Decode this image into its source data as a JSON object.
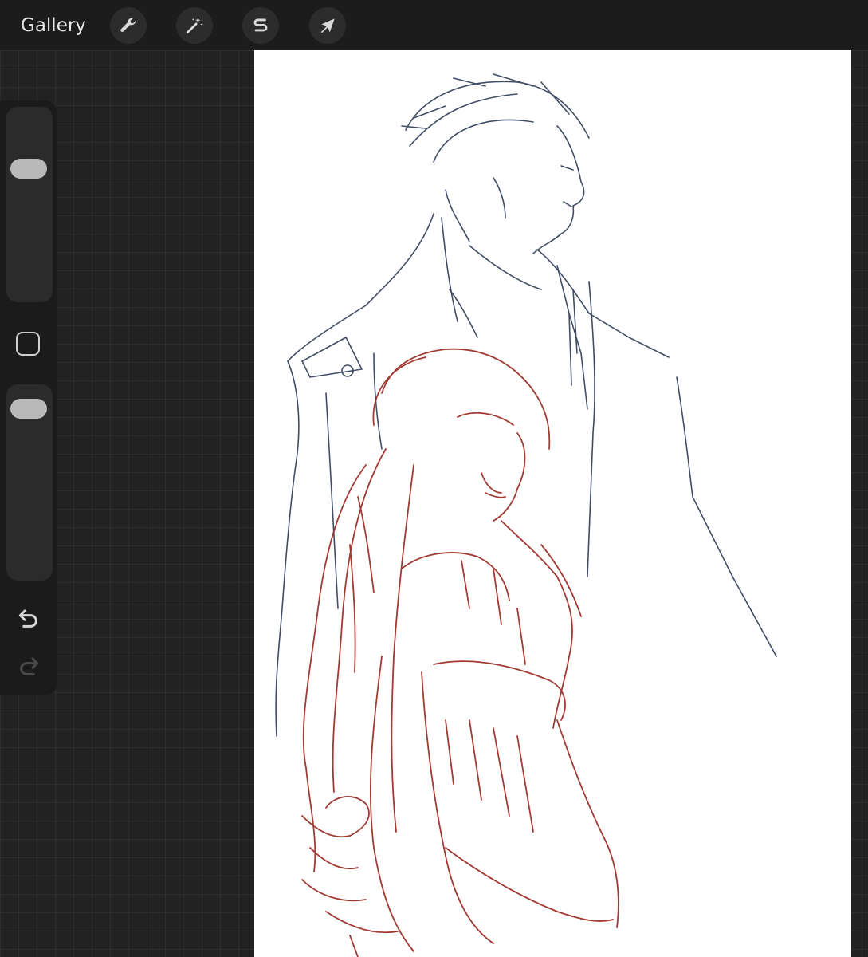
{
  "topbar": {
    "gallery_label": "Gallery",
    "tools": [
      {
        "name": "actions",
        "icon": "wrench-icon"
      },
      {
        "name": "adjustments",
        "icon": "magic-wand-icon"
      },
      {
        "name": "selection",
        "icon": "selection-s-icon"
      },
      {
        "name": "transform",
        "icon": "arrow-cursor-icon"
      }
    ]
  },
  "sidebar": {
    "brush_size_level": 0.28,
    "opacity_level": 0.05,
    "modify_icon": "square-icon",
    "undo_icon": "undo-icon",
    "redo_icon": "redo-icon",
    "redo_enabled": false
  },
  "colors": {
    "ui_background": "#222222",
    "toolbar": "#1c1c1c",
    "canvas": "#ffffff",
    "sketch_blue": "#2c3a55",
    "sketch_red": "#9a2a22"
  }
}
